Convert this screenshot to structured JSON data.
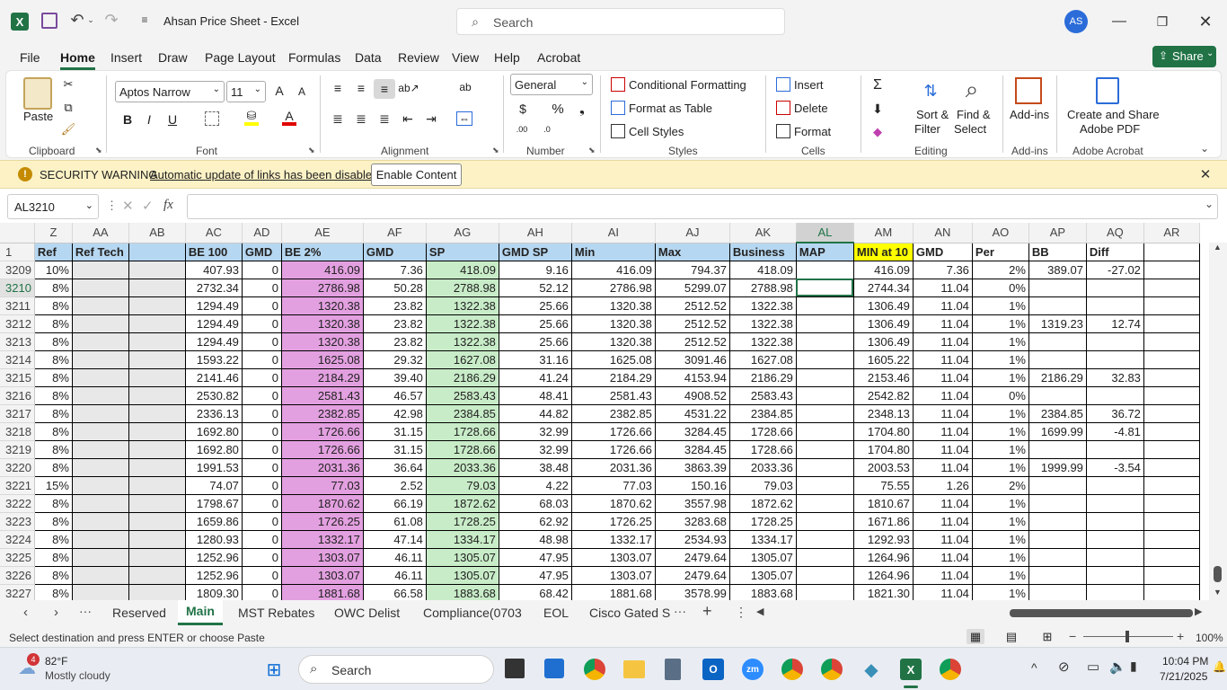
{
  "app": {
    "title": "Ahsan Price Sheet  -  Excel",
    "search_placeholder": "Search",
    "user_initials": "AS"
  },
  "menu": {
    "items": [
      "File",
      "Home",
      "Insert",
      "Draw",
      "Page Layout",
      "Formulas",
      "Data",
      "Review",
      "View",
      "Help",
      "Acrobat"
    ],
    "share_label": "Share"
  },
  "ribbon": {
    "paste": "Paste",
    "clipboard": "Clipboard",
    "font_name": "Aptos Narrow",
    "font_size": "11",
    "font": "Font",
    "alignment": "Alignment",
    "number_format": "General",
    "number": "Number",
    "conditional_formatting": "Conditional Formatting",
    "format_as_table": "Format as Table",
    "cell_styles": "Cell Styles",
    "styles": "Styles",
    "insert": "Insert",
    "delete": "Delete",
    "format": "Format",
    "cells": "Cells",
    "sort_filter_1": "Sort &",
    "sort_filter_2": "Filter",
    "find_select_1": "Find &",
    "find_select_2": "Select",
    "editing": "Editing",
    "addins": "Add-ins",
    "addins_group": "Add-ins",
    "create_share_1": "Create and Share",
    "create_share_2": "Adobe PDF",
    "adobe_acrobat": "Adobe Acrobat"
  },
  "security": {
    "title": "SECURITY WARNING",
    "message": "Automatic update of links has been disabled",
    "button": "Enable Content"
  },
  "formula_bar": {
    "name_box": "AL3210",
    "formula": ""
  },
  "grid": {
    "columns": [
      "Z",
      "AA",
      "AB",
      "AC",
      "AD",
      "AE",
      "AF",
      "AG",
      "AH",
      "AI",
      "AJ",
      "AK",
      "AL",
      "AM",
      "AN",
      "AO",
      "AP",
      "AQ",
      "AR"
    ],
    "header_row_num": "1",
    "headers": [
      "Ref",
      "Ref Tech",
      "",
      "BE 100",
      "GMD",
      "BE 2%",
      "GMD",
      "SP",
      "GMD SP",
      "Min",
      "Max",
      "Business",
      "MAP",
      "MIN at 10",
      "GMD",
      "Per",
      "BB",
      "Diff",
      ""
    ],
    "rows": [
      [
        "3209",
        "10%",
        "",
        "",
        "407.93",
        "0",
        "416.09",
        "7.36",
        "418.09",
        "9.16",
        "416.09",
        "794.37",
        "418.09",
        "",
        "416.09",
        "7.36",
        "2%",
        "389.07",
        "-27.02",
        ""
      ],
      [
        "3210",
        "8%",
        "",
        "",
        "2732.34",
        "0",
        "2786.98",
        "50.28",
        "2788.98",
        "52.12",
        "2786.98",
        "5299.07",
        "2788.98",
        "",
        "2744.34",
        "11.04",
        "0%",
        "",
        "",
        ""
      ],
      [
        "3211",
        "8%",
        "",
        "",
        "1294.49",
        "0",
        "1320.38",
        "23.82",
        "1322.38",
        "25.66",
        "1320.38",
        "2512.52",
        "1322.38",
        "",
        "1306.49",
        "11.04",
        "1%",
        "",
        "",
        ""
      ],
      [
        "3212",
        "8%",
        "",
        "",
        "1294.49",
        "0",
        "1320.38",
        "23.82",
        "1322.38",
        "25.66",
        "1320.38",
        "2512.52",
        "1322.38",
        "",
        "1306.49",
        "11.04",
        "1%",
        "1319.23",
        "12.74",
        ""
      ],
      [
        "3213",
        "8%",
        "",
        "",
        "1294.49",
        "0",
        "1320.38",
        "23.82",
        "1322.38",
        "25.66",
        "1320.38",
        "2512.52",
        "1322.38",
        "",
        "1306.49",
        "11.04",
        "1%",
        "",
        "",
        ""
      ],
      [
        "3214",
        "8%",
        "",
        "",
        "1593.22",
        "0",
        "1625.08",
        "29.32",
        "1627.08",
        "31.16",
        "1625.08",
        "3091.46",
        "1627.08",
        "",
        "1605.22",
        "11.04",
        "1%",
        "",
        "",
        ""
      ],
      [
        "3215",
        "8%",
        "",
        "",
        "2141.46",
        "0",
        "2184.29",
        "39.40",
        "2186.29",
        "41.24",
        "2184.29",
        "4153.94",
        "2186.29",
        "",
        "2153.46",
        "11.04",
        "1%",
        "2186.29",
        "32.83",
        ""
      ],
      [
        "3216",
        "8%",
        "",
        "",
        "2530.82",
        "0",
        "2581.43",
        "46.57",
        "2583.43",
        "48.41",
        "2581.43",
        "4908.52",
        "2583.43",
        "",
        "2542.82",
        "11.04",
        "0%",
        "",
        "",
        ""
      ],
      [
        "3217",
        "8%",
        "",
        "",
        "2336.13",
        "0",
        "2382.85",
        "42.98",
        "2384.85",
        "44.82",
        "2382.85",
        "4531.22",
        "2384.85",
        "",
        "2348.13",
        "11.04",
        "1%",
        "2384.85",
        "36.72",
        ""
      ],
      [
        "3218",
        "8%",
        "",
        "",
        "1692.80",
        "0",
        "1726.66",
        "31.15",
        "1728.66",
        "32.99",
        "1726.66",
        "3284.45",
        "1728.66",
        "",
        "1704.80",
        "11.04",
        "1%",
        "1699.99",
        "-4.81",
        ""
      ],
      [
        "3219",
        "8%",
        "",
        "",
        "1692.80",
        "0",
        "1726.66",
        "31.15",
        "1728.66",
        "32.99",
        "1726.66",
        "3284.45",
        "1728.66",
        "",
        "1704.80",
        "11.04",
        "1%",
        "",
        "",
        ""
      ],
      [
        "3220",
        "8%",
        "",
        "",
        "1991.53",
        "0",
        "2031.36",
        "36.64",
        "2033.36",
        "38.48",
        "2031.36",
        "3863.39",
        "2033.36",
        "",
        "2003.53",
        "11.04",
        "1%",
        "1999.99",
        "-3.54",
        ""
      ],
      [
        "3221",
        "15%",
        "",
        "",
        "74.07",
        "0",
        "77.03",
        "2.52",
        "79.03",
        "4.22",
        "77.03",
        "150.16",
        "79.03",
        "",
        "75.55",
        "1.26",
        "2%",
        "",
        "",
        ""
      ],
      [
        "3222",
        "8%",
        "",
        "",
        "1798.67",
        "0",
        "1870.62",
        "66.19",
        "1872.62",
        "68.03",
        "1870.62",
        "3557.98",
        "1872.62",
        "",
        "1810.67",
        "11.04",
        "1%",
        "",
        "",
        ""
      ],
      [
        "3223",
        "8%",
        "",
        "",
        "1659.86",
        "0",
        "1726.25",
        "61.08",
        "1728.25",
        "62.92",
        "1726.25",
        "3283.68",
        "1728.25",
        "",
        "1671.86",
        "11.04",
        "1%",
        "",
        "",
        ""
      ],
      [
        "3224",
        "8%",
        "",
        "",
        "1280.93",
        "0",
        "1332.17",
        "47.14",
        "1334.17",
        "48.98",
        "1332.17",
        "2534.93",
        "1334.17",
        "",
        "1292.93",
        "11.04",
        "1%",
        "",
        "",
        ""
      ],
      [
        "3225",
        "8%",
        "",
        "",
        "1252.96",
        "0",
        "1303.07",
        "46.11",
        "1305.07",
        "47.95",
        "1303.07",
        "2479.64",
        "1305.07",
        "",
        "1264.96",
        "11.04",
        "1%",
        "",
        "",
        ""
      ],
      [
        "3226",
        "8%",
        "",
        "",
        "1252.96",
        "0",
        "1303.07",
        "46.11",
        "1305.07",
        "47.95",
        "1303.07",
        "2479.64",
        "1305.07",
        "",
        "1264.96",
        "11.04",
        "1%",
        "",
        "",
        ""
      ],
      [
        "3227",
        "8%",
        "",
        "",
        "1809.30",
        "0",
        "1881.68",
        "66.58",
        "1883.68",
        "68.42",
        "1881.68",
        "3578.99",
        "1883.68",
        "",
        "1821.30",
        "11.04",
        "1%",
        "",
        "",
        ""
      ]
    ]
  },
  "sheets": {
    "tabs": [
      "Reserved",
      "Main",
      "MST Rebates",
      "OWC Delist",
      "Compliance(0703",
      "EOL",
      "Cisco Gated S"
    ],
    "active": "Main"
  },
  "status": {
    "message": "Select destination and press ENTER or choose Paste",
    "zoom": "100%"
  },
  "taskbar": {
    "weather_temp": "82°F",
    "weather_desc": "Mostly cloudy",
    "weather_badge": "4",
    "search": "Search",
    "time": "10:04 PM",
    "date": "7/21/2025"
  },
  "colors": {
    "excel_green": "#217346",
    "header_blue": "#b6d7f1",
    "pink": "#e3a0e0",
    "green": "#c8ecc8",
    "yellow": "#ffff00"
  }
}
